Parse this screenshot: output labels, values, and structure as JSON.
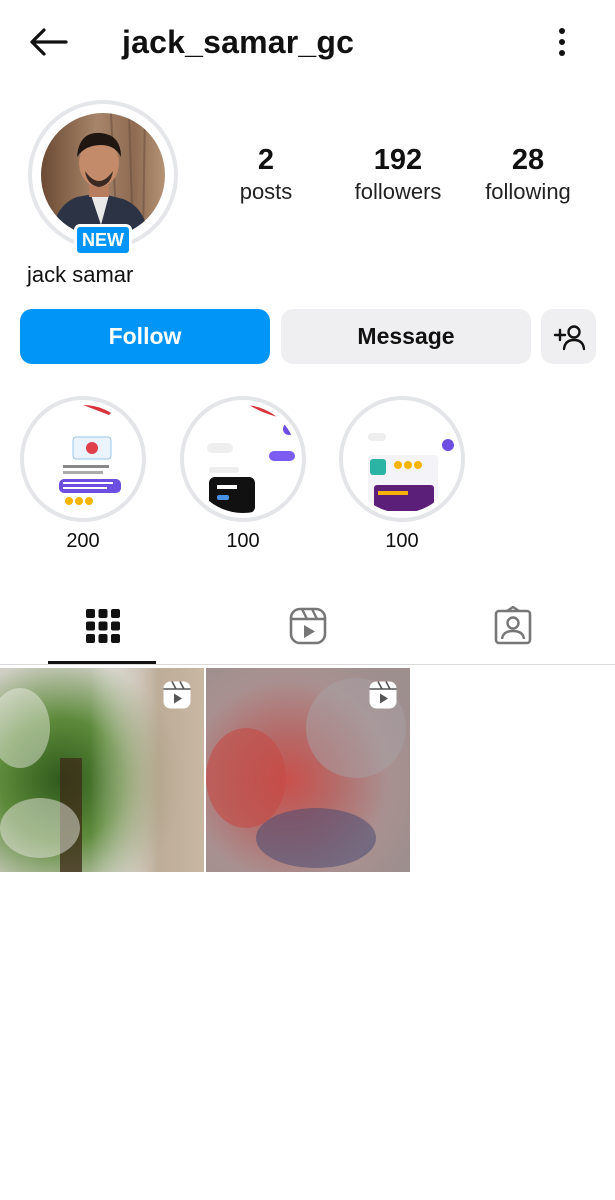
{
  "header": {
    "username": "jack_samar_gc",
    "back_icon": "arrow-left-icon",
    "more_icon": "more-vertical-icon"
  },
  "profile": {
    "display_name": "jack samar",
    "badge": "NEW",
    "stats": {
      "posts": {
        "value": "2",
        "label": "posts"
      },
      "followers": {
        "value": "192",
        "label": "followers"
      },
      "following": {
        "value": "28",
        "label": "following"
      }
    }
  },
  "actions": {
    "follow_label": "Follow",
    "message_label": "Message",
    "add_user_icon": "add-user-icon"
  },
  "highlights": [
    {
      "label": "200"
    },
    {
      "label": "100"
    },
    {
      "label": "100"
    }
  ],
  "tabs": [
    {
      "icon": "grid-icon",
      "active": true
    },
    {
      "icon": "reels-icon",
      "active": false
    },
    {
      "icon": "tagged-icon",
      "active": false
    }
  ],
  "posts": [
    {
      "type": "reel",
      "icon": "reel-icon"
    },
    {
      "type": "reel",
      "icon": "reel-icon"
    }
  ],
  "colors": {
    "accent": "#0095f6",
    "button_secondary": "#efeff1",
    "ring": "#e4e6ea"
  }
}
